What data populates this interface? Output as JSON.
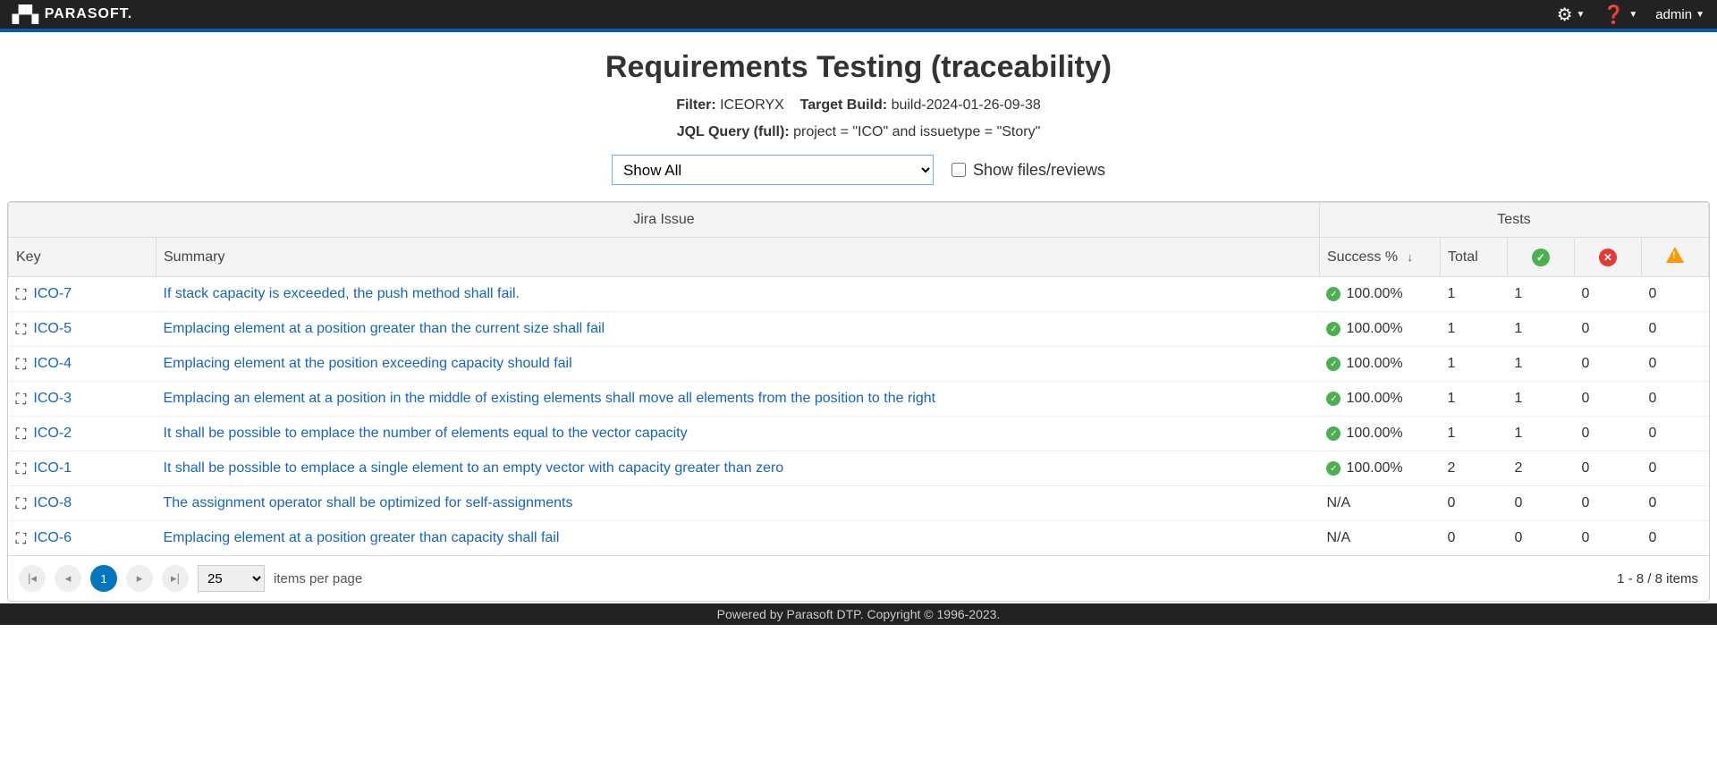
{
  "header": {
    "brand": "PARASOFT.",
    "user": "admin"
  },
  "page": {
    "title": "Requirements Testing (traceability)",
    "filter_label": "Filter:",
    "filter_value": "ICEORYX",
    "target_label": "Target Build:",
    "target_value": "build-2024-01-26-09-38",
    "jql_label": "JQL Query (full):",
    "jql_value": "project = \"ICO\" and issuetype = \"Story\"",
    "show_filter": "Show All",
    "show_files_label": "Show files/reviews"
  },
  "columns": {
    "group_issue": "Jira Issue",
    "group_tests": "Tests",
    "key": "Key",
    "summary": "Summary",
    "success": "Success %",
    "total": "Total"
  },
  "rows": [
    {
      "key": "ICO-7",
      "summary": "If stack capacity is exceeded, the push method shall fail.",
      "success": "100.00%",
      "has_success_icon": true,
      "total": "1",
      "pass": "1",
      "fail": "0",
      "warn": "0"
    },
    {
      "key": "ICO-5",
      "summary": "Emplacing element at a position greater than the current size shall fail",
      "success": "100.00%",
      "has_success_icon": true,
      "total": "1",
      "pass": "1",
      "fail": "0",
      "warn": "0"
    },
    {
      "key": "ICO-4",
      "summary": "Emplacing element at the position exceeding capacity should fail",
      "success": "100.00%",
      "has_success_icon": true,
      "total": "1",
      "pass": "1",
      "fail": "0",
      "warn": "0"
    },
    {
      "key": "ICO-3",
      "summary": "Emplacing an element at a position in the middle of existing elements shall move all elements from the position to the right",
      "success": "100.00%",
      "has_success_icon": true,
      "total": "1",
      "pass": "1",
      "fail": "0",
      "warn": "0"
    },
    {
      "key": "ICO-2",
      "summary": "It shall be possible to emplace the number of elements equal to the vector capacity",
      "success": "100.00%",
      "has_success_icon": true,
      "total": "1",
      "pass": "1",
      "fail": "0",
      "warn": "0"
    },
    {
      "key": "ICO-1",
      "summary": "It shall be possible to emplace a single element to an empty vector with capacity greater than zero",
      "success": "100.00%",
      "has_success_icon": true,
      "total": "2",
      "pass": "2",
      "fail": "0",
      "warn": "0"
    },
    {
      "key": "ICO-8",
      "summary": "The assignment operator shall be optimized for self-assignments",
      "success": "N/A",
      "has_success_icon": false,
      "total": "0",
      "pass": "0",
      "fail": "0",
      "warn": "0"
    },
    {
      "key": "ICO-6",
      "summary": "Emplacing element at a position greater than capacity shall fail",
      "success": "N/A",
      "has_success_icon": false,
      "total": "0",
      "pass": "0",
      "fail": "0",
      "warn": "0"
    }
  ],
  "pager": {
    "current": "1",
    "pagesize": "25",
    "ipp": "items per page",
    "range": "1 - 8 / 8 items"
  },
  "footer": "Powered by Parasoft DTP. Copyright © 1996-2023."
}
